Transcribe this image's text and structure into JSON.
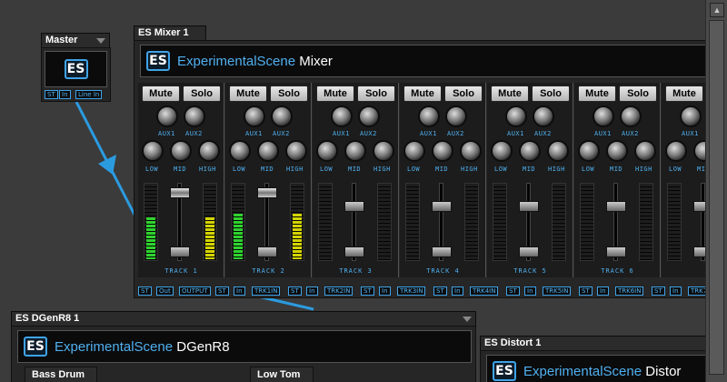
{
  "colors": {
    "accent": "#3fa3e8",
    "meter_green": "#2fd22f",
    "meter_yellow": "#d4d400",
    "panel": "#262626"
  },
  "logo_glyph": "ES",
  "master": {
    "title": "Master",
    "ports": [
      "ST",
      "In",
      "Line In"
    ]
  },
  "mixer": {
    "title": "ES Mixer 1",
    "brand1": "ExperimentalScene",
    "brand2": "Mixer",
    "mute_label": "Mute",
    "solo_label": "Solo",
    "aux1": "AUX1",
    "aux2": "AUX2",
    "low": "LOW",
    "mid": "MID",
    "high": "HIGH",
    "tracks": [
      "TRACK 1",
      "TRACK 2",
      "TRACK 3",
      "TRACK 4",
      "TRACK 5",
      "TRACK 6"
    ],
    "track1_level": 0.55,
    "track2_level": 0.6,
    "ports": [
      "ST",
      "Out",
      "OUTPUT",
      "ST",
      "In",
      "TRK1IN",
      "ST",
      "In",
      "TRK2IN",
      "ST",
      "In",
      "TRK3IN",
      "ST",
      "In",
      "TRK4IN",
      "ST",
      "In",
      "TRK5IN",
      "ST",
      "In",
      "TRK6IN",
      "ST",
      "In",
      "TRK7IN",
      "ST",
      "In"
    ]
  },
  "dgenr8": {
    "title": "ES DGenR8 1",
    "brand1": "ExperimentalScene",
    "brand2": "DGenR8",
    "section1": "Bass Drum",
    "section2": "Low Tom"
  },
  "distort": {
    "title": "ES Distort 1",
    "brand1": "ExperimentalScene",
    "brand2": "Distor"
  }
}
